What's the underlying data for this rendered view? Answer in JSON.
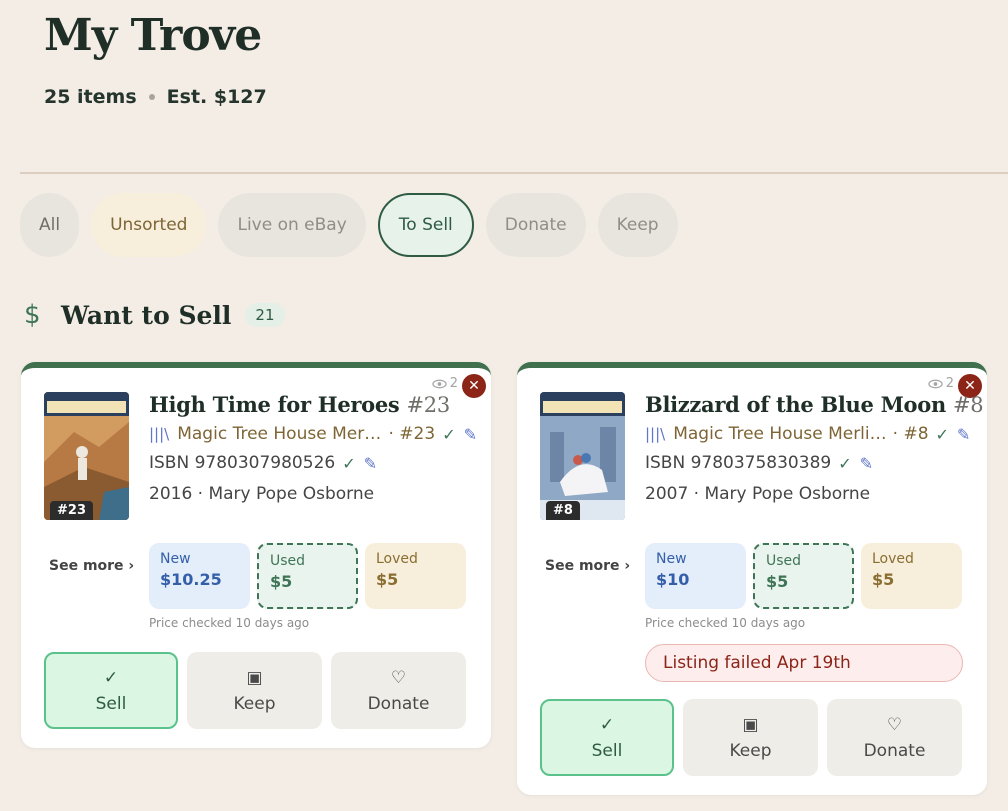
{
  "header": {
    "title": "My Trove",
    "items_count": "25 items",
    "estimate": "Est. $127"
  },
  "filters": [
    "All",
    "Unsorted",
    "Live on eBay",
    "To Sell",
    "Donate",
    "Keep"
  ],
  "active_filter": "To Sell",
  "section": {
    "icon": "dollar-icon",
    "title": "Want to Sell",
    "count": "21"
  },
  "colors": {
    "accent": "#41704f",
    "danger": "#8c2417"
  },
  "cards": [
    {
      "views": "2",
      "title": "High Time for Heroes",
      "title_num": "#23",
      "cover_num": "#23",
      "series": "Magic Tree House Merl…",
      "series_num": "· #23",
      "isbn": "ISBN 9780307980526",
      "meta": "2016 · Mary Pope Osborne",
      "see_more": "See more ›",
      "prices": {
        "new_label": "New",
        "new_value": "$10.25",
        "used_label": "Used",
        "used_value": "$5",
        "loved_label": "Loved",
        "loved_value": "$5"
      },
      "price_note": "Price checked 10 days ago",
      "actions": {
        "sell": "Sell",
        "keep": "Keep",
        "donate": "Donate"
      }
    },
    {
      "views": "2",
      "title": "Blizzard of the Blue Moon",
      "title_num": "#8",
      "cover_num": "#8",
      "series": "Magic Tree House Merli…",
      "series_num": "· #8",
      "isbn": "ISBN 9780375830389",
      "meta": "2007 · Mary Pope Osborne",
      "see_more": "See more ›",
      "prices": {
        "new_label": "New",
        "new_value": "$10",
        "used_label": "Used",
        "used_value": "$5",
        "loved_label": "Loved",
        "loved_value": "$5"
      },
      "price_note": "Price checked 10 days ago",
      "status": "Listing failed Apr 19th",
      "actions": {
        "sell": "Sell",
        "keep": "Keep",
        "donate": "Donate"
      }
    }
  ]
}
